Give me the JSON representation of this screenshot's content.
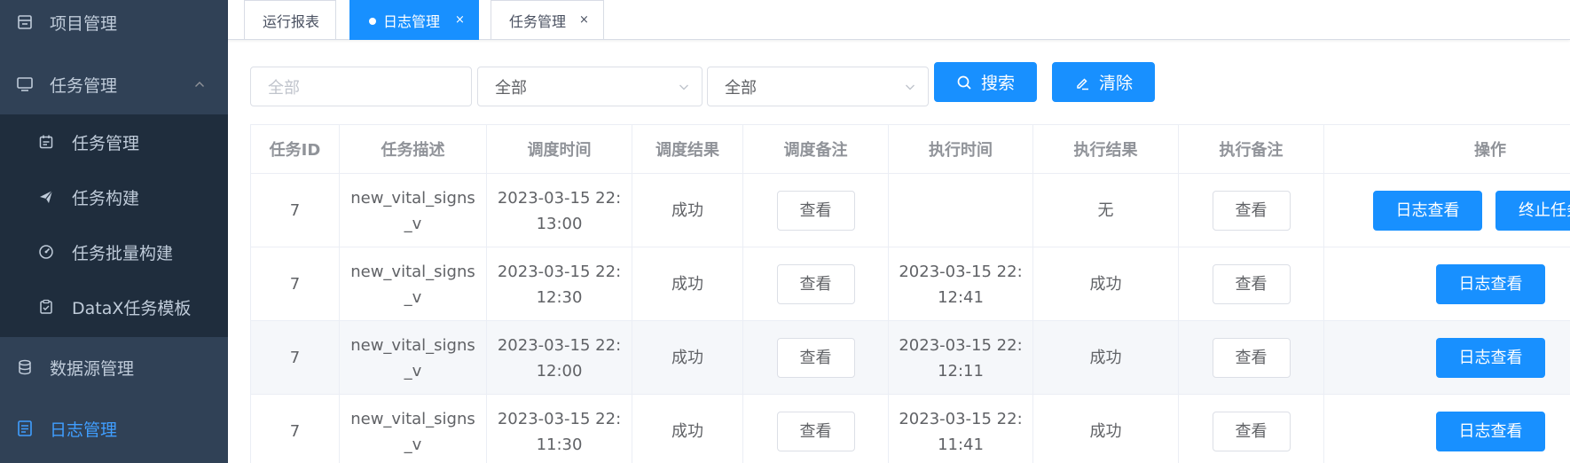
{
  "sidebar": {
    "items": [
      {
        "label": "项目管理",
        "icon": "project-icon"
      },
      {
        "label": "任务管理",
        "icon": "monitor-icon",
        "expanded": true
      },
      {
        "label": "数据源管理",
        "icon": "database-icon"
      },
      {
        "label": "日志管理",
        "icon": "document-icon",
        "active": true
      }
    ],
    "subitems": [
      {
        "label": "任务管理",
        "icon": "calendar-icon"
      },
      {
        "label": "任务构建",
        "icon": "paper-plane-icon"
      },
      {
        "label": "任务批量构建",
        "icon": "dashboard-icon"
      },
      {
        "label": "DataX任务模板",
        "icon": "clipboard-icon"
      }
    ]
  },
  "tabs": [
    {
      "label": "运行报表",
      "active": false
    },
    {
      "label": "日志管理",
      "active": true,
      "close": "×"
    },
    {
      "label": "任务管理",
      "active": false,
      "close": "×"
    }
  ],
  "filters": {
    "input_placeholder": "全部",
    "select1_value": "全部",
    "select2_value": "全部",
    "search_label": "搜索",
    "clear_label": "清除"
  },
  "table": {
    "headers": [
      "任务ID",
      "任务描述",
      "调度时间",
      "调度结果",
      "调度备注",
      "执行时间",
      "执行结果",
      "执行备注",
      "操作"
    ],
    "view_label": "查看",
    "log_label": "日志查看",
    "stop_label": "终止任务",
    "rows": [
      {
        "id": "7",
        "desc": "new_vital_signs_v",
        "trigger_time": "2023-03-15 22:13:00",
        "trigger_result": "成功",
        "handle_time": "",
        "handle_result": "无",
        "can_stop": true
      },
      {
        "id": "7",
        "desc": "new_vital_signs_v",
        "trigger_time": "2023-03-15 22:12:30",
        "trigger_result": "成功",
        "handle_time": "2023-03-15 22:12:41",
        "handle_result": "成功",
        "can_stop": false
      },
      {
        "id": "7",
        "desc": "new_vital_signs_v",
        "trigger_time": "2023-03-15 22:12:00",
        "trigger_result": "成功",
        "handle_time": "2023-03-15 22:12:11",
        "handle_result": "成功",
        "can_stop": false
      },
      {
        "id": "7",
        "desc": "new_vital_signs_v",
        "trigger_time": "2023-03-15 22:11:30",
        "trigger_result": "成功",
        "handle_time": "2023-03-15 22:11:41",
        "handle_result": "成功",
        "can_stop": false
      }
    ]
  },
  "colors": {
    "sidebar_bg": "#304156",
    "submenu_bg": "#1f2d3d",
    "primary": "#1890ff",
    "active_menu_text": "#409eff"
  }
}
